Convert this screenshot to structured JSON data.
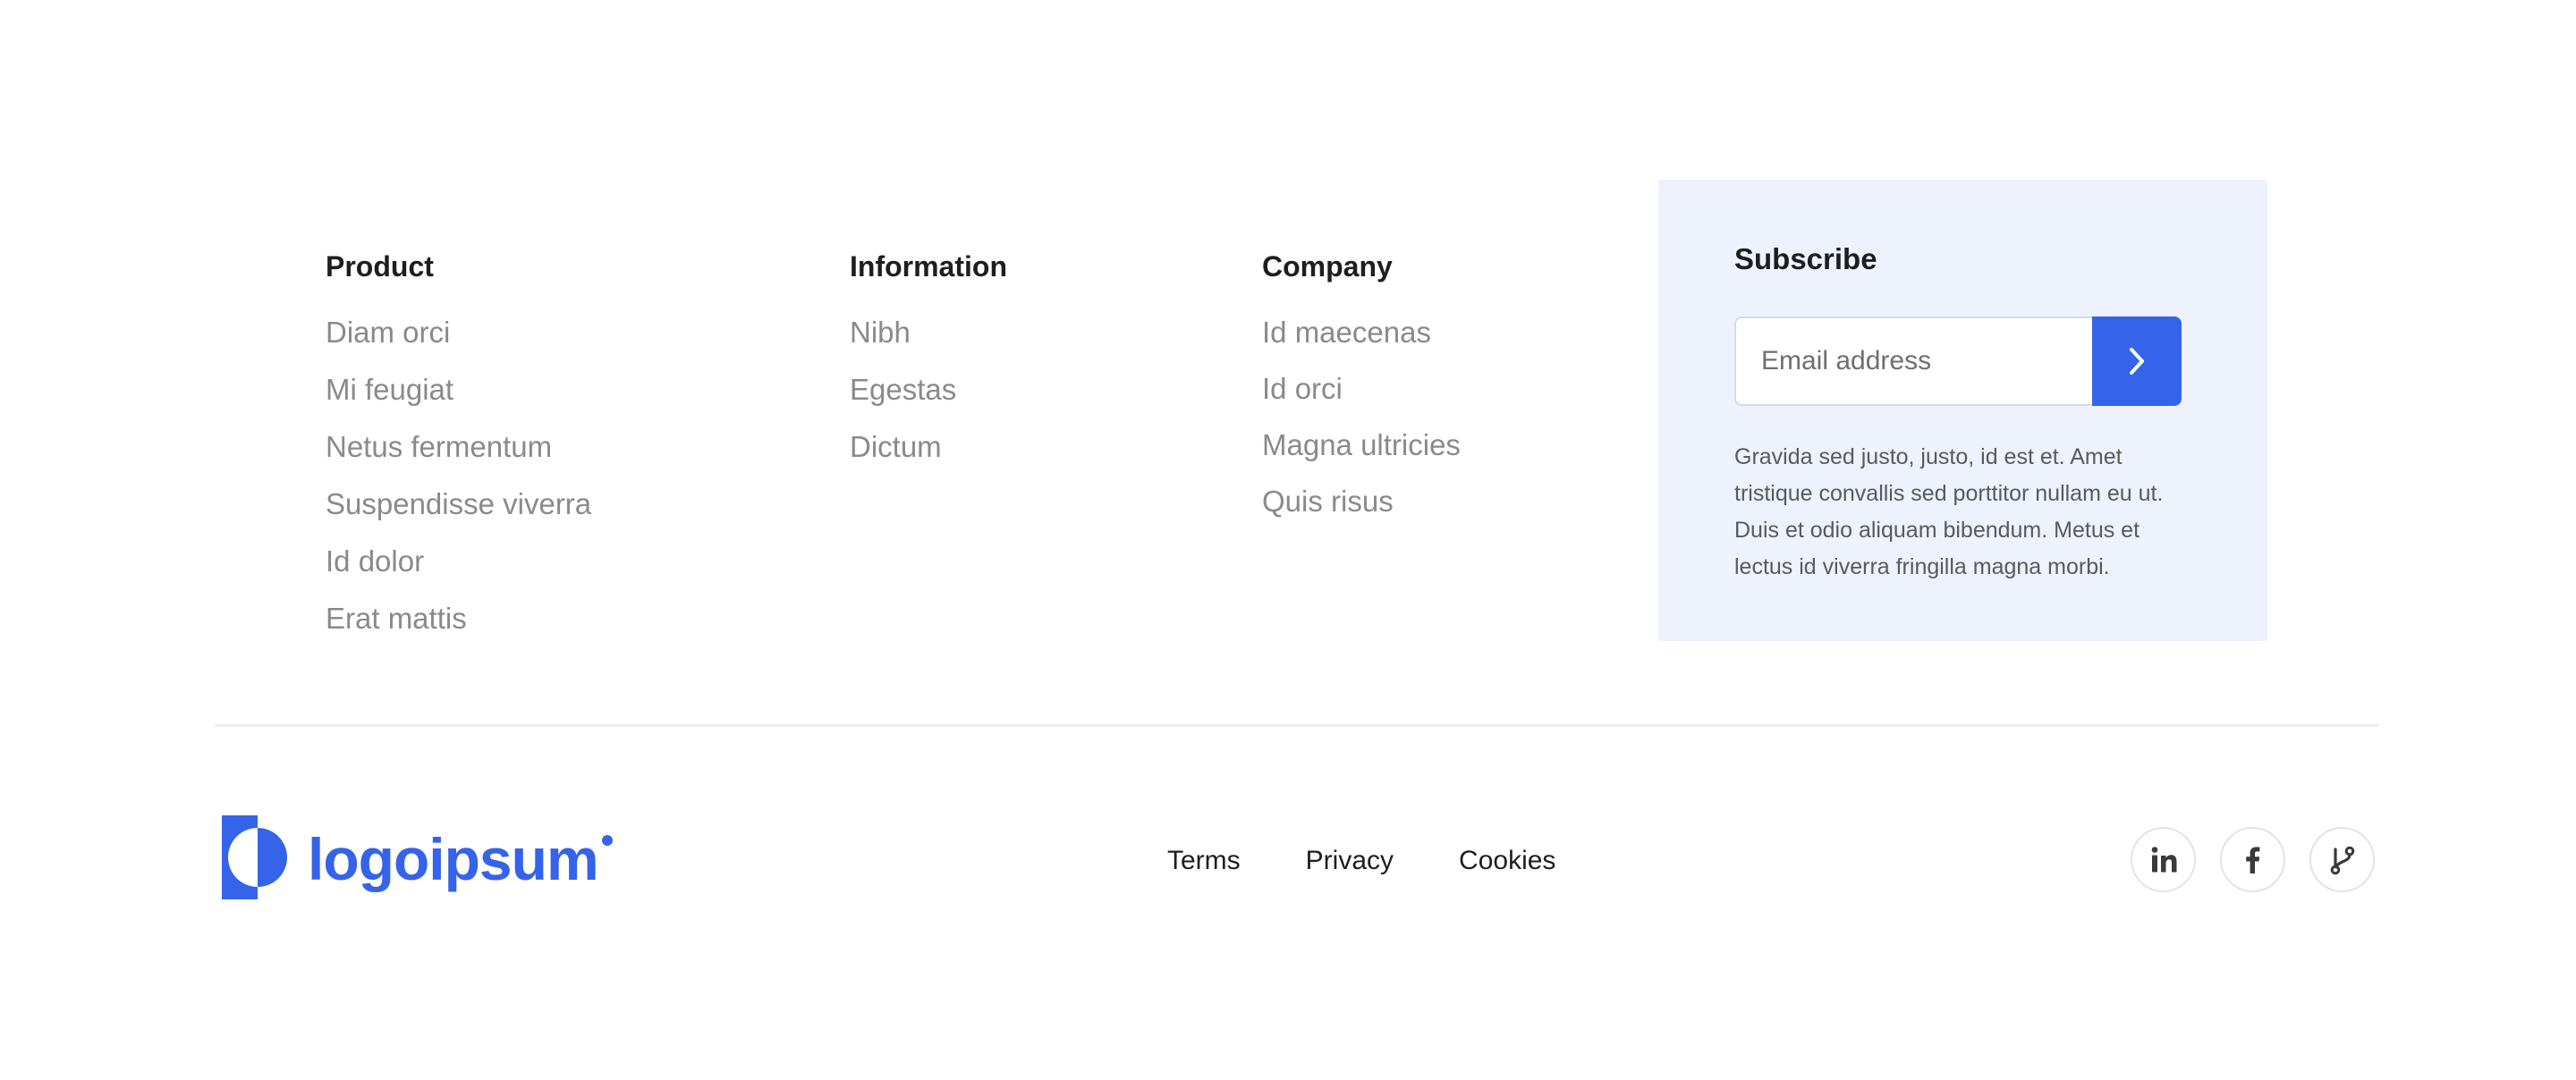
{
  "footer": {
    "columns": {
      "product": {
        "title": "Product",
        "links": [
          "Diam orci",
          "Mi feugiat",
          "Netus fermentum",
          "Suspendisse viverra",
          "Id dolor",
          "Erat mattis"
        ]
      },
      "information": {
        "title": "Information",
        "links": [
          "Nibh",
          "Egestas",
          "Dictum"
        ]
      },
      "company": {
        "title": "Company",
        "links": [
          "Id maecenas",
          "Id orci",
          "Magna ultricies",
          "Quis risus"
        ]
      }
    },
    "subscribe": {
      "title": "Subscribe",
      "email_placeholder": "Email address",
      "email_value": "",
      "submit_icon": "chevron-right-icon",
      "description": "Gravida sed justo, justo, id est et. Amet tristique convallis sed porttitor nullam eu ut. Duis et odio aliquam bibendum. Metus et lectus id viverra fringilla magna morbi."
    },
    "bottom": {
      "logo_text": "logoipsum",
      "legal_links": {
        "terms": "Terms",
        "privacy": "Privacy",
        "cookies": "Cookies"
      },
      "socials": [
        "linkedin-icon",
        "facebook-icon",
        "git-branch-icon"
      ]
    }
  },
  "colors": {
    "accent": "#3563e9",
    "subscribe_background": "#edf2fd",
    "heading_text": "#1e1e1e",
    "muted_link_text": "#8a8a8a",
    "body_text": "#5a5a5a",
    "divider": "#eeeeee"
  }
}
